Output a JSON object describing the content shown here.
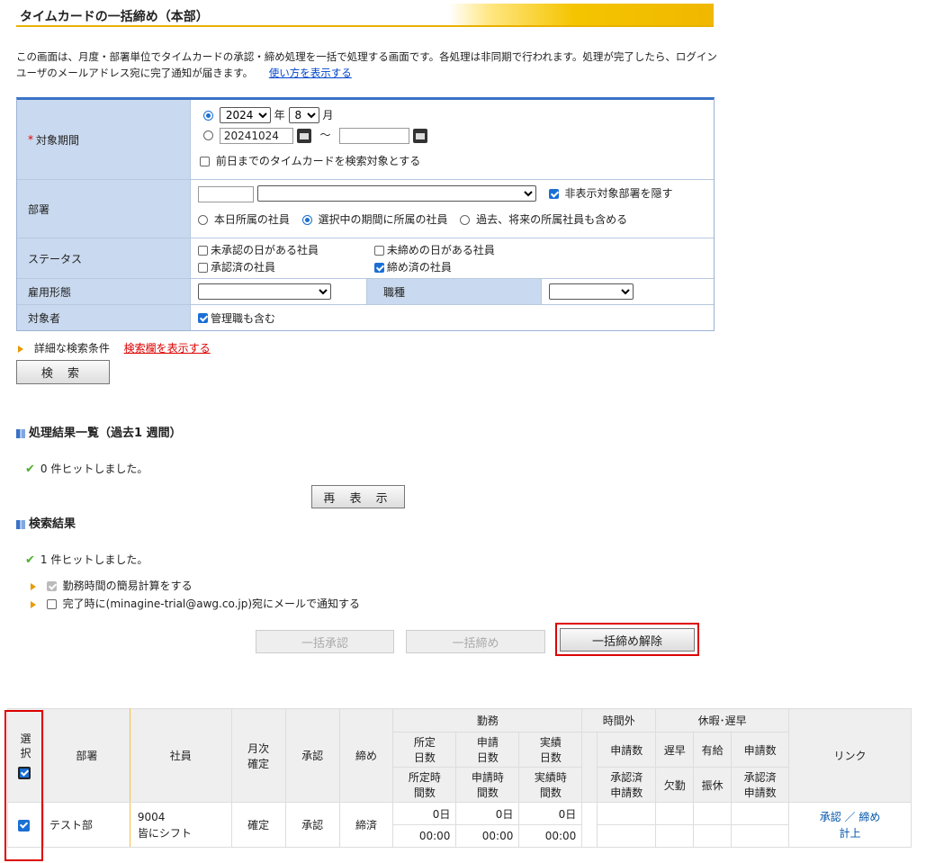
{
  "header": {
    "title": "タイムカードの一括締め（本部）"
  },
  "description": {
    "text": "この画面は、月度・部署単位でタイムカードの承認・締め処理を一括で処理する画面です。各処理は非同期で行われます。処理が完了したら、ログインユーザのメールアドレス宛に完了通知が届きます。",
    "help_link": "使い方を表示する"
  },
  "form": {
    "period": {
      "label": "対象期間",
      "required_mark": "*",
      "year": "2024",
      "year_suffix": "年",
      "month": "8",
      "month_suffix": "月",
      "date_from": "20241024",
      "tilde": "～",
      "date_to": "",
      "prev_day_label": "前日までのタイムカードを検索対象とする"
    },
    "department": {
      "label": "部署",
      "code": "",
      "name": "",
      "hide_label": "非表示対象部署を隠す",
      "opt_today": "本日所属の社員",
      "opt_selected": "選択中の期間に所属の社員",
      "opt_all": "過去、将来の所属社員も含める"
    },
    "status": {
      "label": "ステータス",
      "unapproved": "未承認の日がある社員",
      "unclosed": "未締めの日がある社員",
      "approved": "承認済の社員",
      "closed": "締め済の社員"
    },
    "employment": {
      "label": "雇用形態",
      "value": "",
      "job_label": "職種",
      "job_value": ""
    },
    "target": {
      "label": "対象者",
      "include_managers": "管理職も含む"
    }
  },
  "detail": {
    "label": "詳細な検索条件",
    "link": "検索欄を表示する"
  },
  "buttons": {
    "search": "検 索",
    "redisplay": "再 表 示",
    "bulk_approve": "一括承認",
    "bulk_close": "一括締め",
    "bulk_unclose": "一括締め解除"
  },
  "process_results": {
    "title": "処理結果一覧（過去1 週間）",
    "hits": "0 件ヒットしました。"
  },
  "search_results": {
    "title": "検索結果",
    "hits": "1 件ヒットしました。",
    "simple_calc": "勤務時間の簡易計算をする",
    "notify": "完了時に(minagine-trial@awg.co.jp)宛にメールで通知する"
  },
  "table": {
    "headers": {
      "select": "選択",
      "dept": "部署",
      "employee": "社員",
      "monthly_confirm": "月次確定",
      "approve": "承認",
      "close": "締め",
      "work": "勤務",
      "overtime": "時間外",
      "leave": "休暇･遅早",
      "link": "リンク",
      "scheduled_days": "所定日数",
      "applied_days": "申請日数",
      "actual_days": "実績日数",
      "scheduled_hours": "所定時間数",
      "applied_hours": "申請時間数",
      "actual_hours": "実績時間数",
      "ot_apps": "申請数",
      "ot_approved": "承認済申請数",
      "late": "遅早",
      "paid": "有給",
      "lv_apps": "申請数",
      "absence": "欠勤",
      "substitute": "振休",
      "lv_approved": "承認済申請数"
    },
    "row": {
      "dept": "テスト部",
      "emp_code": "9004",
      "emp_name": "皆にシフト",
      "monthly_confirm": "確定",
      "approve": "承認",
      "close": "締済",
      "scheduled_days": "0日",
      "applied_days": "0日",
      "actual_days": "0日",
      "scheduled_hours": "00:00",
      "applied_hours": "00:00",
      "actual_hours": "00:00",
      "link_approve": "承認",
      "link_sep": "／",
      "link_close": "締め",
      "link_post": "計上"
    }
  }
}
